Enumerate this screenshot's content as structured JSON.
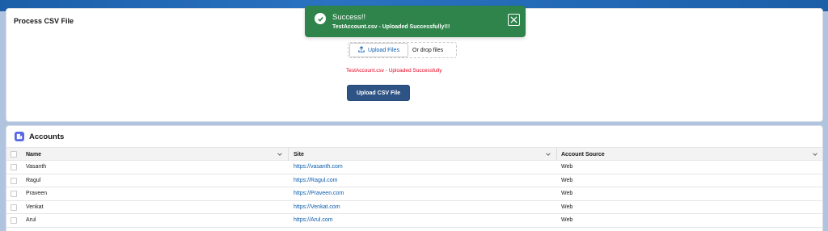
{
  "process_card": {
    "title": "Process CSV File",
    "upload_files_label": "Upload Files",
    "drop_text": "Or drop files",
    "status_message": "TestAccount.csv - Uploaded Successfully",
    "upload_button_label": "Upload CSV File"
  },
  "toast": {
    "heading": "Success!!",
    "message": "TestAccount.csv - Uploaded Successfully!!!",
    "color": "#2e844a"
  },
  "accounts": {
    "title": "Accounts",
    "columns": [
      "Name",
      "Site",
      "Account Source"
    ],
    "rows": [
      {
        "name": "Vasanth",
        "site": "https://vasanth.com",
        "source": "Web"
      },
      {
        "name": "Ragul",
        "site": "https://Ragul.com",
        "source": "Web"
      },
      {
        "name": "Praveen",
        "site": "https://Praveen.com",
        "source": "Web"
      },
      {
        "name": "Venkat",
        "site": "https://Venkat.com",
        "source": "Web"
      },
      {
        "name": "Arul",
        "site": "https://Arul.com",
        "source": "Web"
      }
    ]
  },
  "colors": {
    "brand_button": "#2e5385",
    "link": "#0b5cab",
    "error_text": "#ea001e",
    "accounts_icon": "#5867e8"
  }
}
